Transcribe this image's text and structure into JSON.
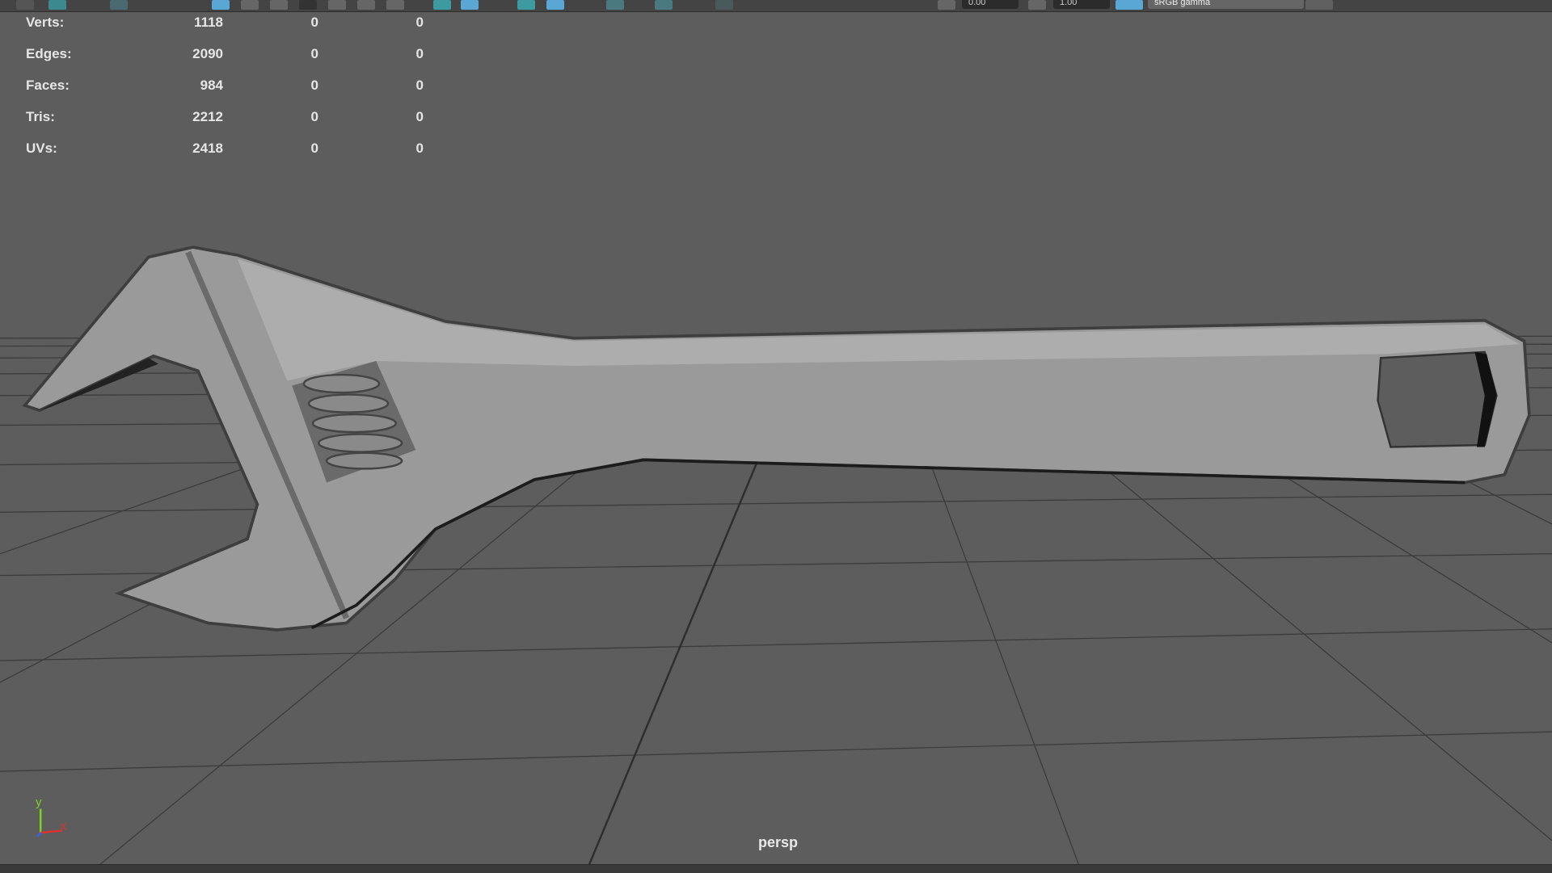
{
  "toolbar": {
    "exposure_value": "0.00",
    "gamma_value": "1.00",
    "color_space": "sRGB gamma",
    "accent_color": "#5aa6d4",
    "icon_color": "#38c0c8"
  },
  "stats": {
    "rows": [
      {
        "label": "Verts:",
        "v1": "1118",
        "v2": "0",
        "v3": "0"
      },
      {
        "label": "Edges:",
        "v1": "2090",
        "v2": "0",
        "v3": "0"
      },
      {
        "label": "Faces:",
        "v1": "984",
        "v2": "0",
        "v3": "0"
      },
      {
        "label": "Tris:",
        "v1": "2212",
        "v2": "0",
        "v3": "0"
      },
      {
        "label": "UVs:",
        "v1": "2418",
        "v2": "0",
        "v3": "0"
      }
    ]
  },
  "viewport": {
    "camera_label": "persp",
    "axis_y": "y",
    "axis_x": "x",
    "axis_y_color": "#7ed321",
    "axis_x_color": "#e03030",
    "axis_z_color": "#3060ff"
  }
}
